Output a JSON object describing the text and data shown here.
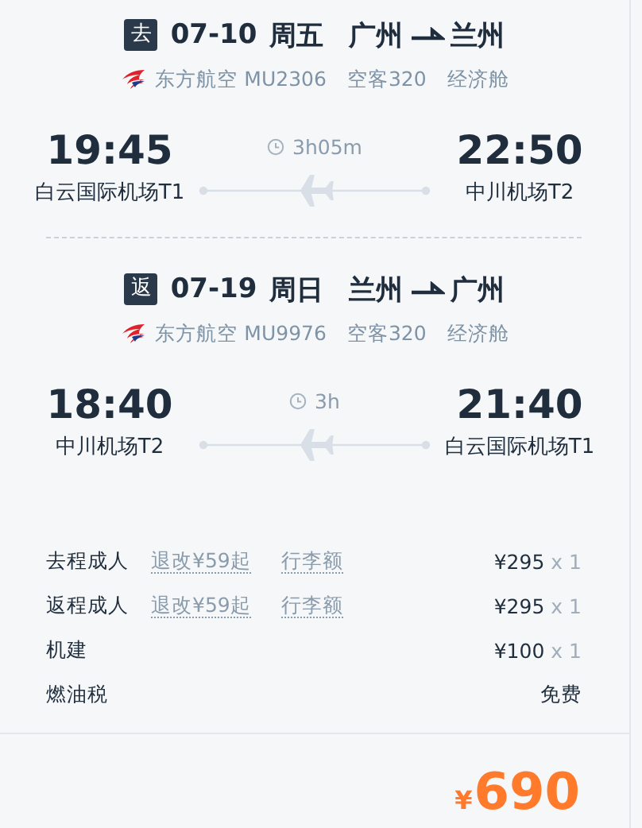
{
  "legs": [
    {
      "tag": "去",
      "date": "07-10",
      "weekday": "周五",
      "from": "广州",
      "to": "兰州",
      "airline": "东方航空 MU2306",
      "aircraft": "空客320",
      "cabin": "经济舱",
      "depart_time": "19:45",
      "depart_airport": "白云国际机场T1",
      "duration": "3h05m",
      "arrive_time": "22:50",
      "arrive_airport": "中川机场T2"
    },
    {
      "tag": "返",
      "date": "07-19",
      "weekday": "周日",
      "from": "兰州",
      "to": "广州",
      "airline": "东方航空 MU9976",
      "aircraft": "空客320",
      "cabin": "经济舱",
      "depart_time": "18:40",
      "depart_airport": "中川机场T2",
      "duration": "3h",
      "arrive_time": "21:40",
      "arrive_airport": "白云国际机场T1"
    }
  ],
  "fees": [
    {
      "label": "去程成人",
      "links": [
        "退改¥59起",
        "行李额"
      ],
      "price": "¥295",
      "quantity": "x 1"
    },
    {
      "label": "返程成人",
      "links": [
        "退改¥59起",
        "行李额"
      ],
      "price": "¥295",
      "quantity": "x 1"
    },
    {
      "label": "机建",
      "price": "¥100",
      "quantity": "x 1"
    },
    {
      "label": "燃油税",
      "price": "免费"
    }
  ],
  "total": {
    "currency": "¥",
    "amount": "690"
  }
}
